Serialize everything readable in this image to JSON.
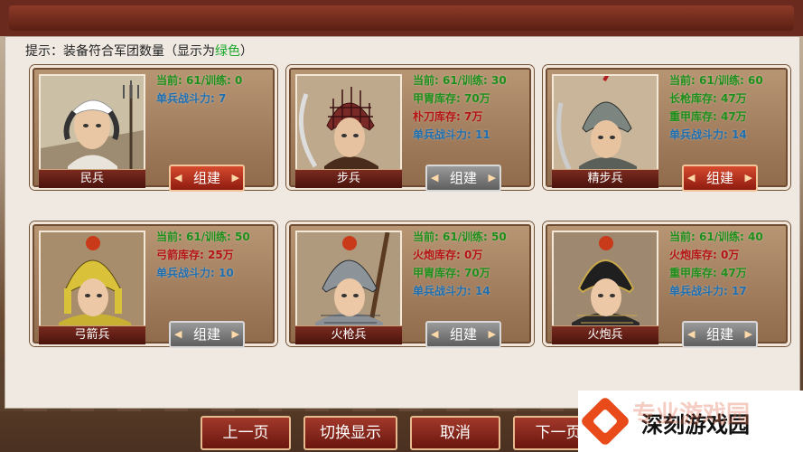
{
  "hint": {
    "prefix": "提示：装备符合军团数量（显示为",
    "highlight": "绿色",
    "suffix": "）"
  },
  "units": [
    {
      "name": "民兵",
      "button": "组建",
      "button_state": "active",
      "stats": [
        {
          "text": "当前: 61/训练: 0",
          "color": "green"
        },
        {
          "text": "单兵战斗力: 7",
          "color": "blue"
        }
      ]
    },
    {
      "name": "步兵",
      "button": "组建",
      "button_state": "disabled",
      "stats": [
        {
          "text": "当前: 61/训练: 30",
          "color": "green"
        },
        {
          "text": "甲胄库存: 70万",
          "color": "green"
        },
        {
          "text": "朴刀库存: 7万",
          "color": "red"
        },
        {
          "text": "单兵战斗力: 11",
          "color": "blue"
        }
      ]
    },
    {
      "name": "精步兵",
      "button": "组建",
      "button_state": "active",
      "stats": [
        {
          "text": "当前: 61/训练: 60",
          "color": "green"
        },
        {
          "text": "长枪库存: 47万",
          "color": "green"
        },
        {
          "text": "重甲库存: 47万",
          "color": "green"
        },
        {
          "text": "单兵战斗力: 14",
          "color": "blue"
        }
      ]
    },
    {
      "name": "弓箭兵",
      "button": "组建",
      "button_state": "disabled",
      "stats": [
        {
          "text": "当前: 61/训练: 50",
          "color": "green"
        },
        {
          "text": "弓箭库存: 25万",
          "color": "red"
        },
        {
          "text": "单兵战斗力: 10",
          "color": "blue"
        }
      ]
    },
    {
      "name": "火枪兵",
      "button": "组建",
      "button_state": "disabled",
      "stats": [
        {
          "text": "当前: 61/训练: 50",
          "color": "green"
        },
        {
          "text": "火炮库存: 0万",
          "color": "red"
        },
        {
          "text": "甲胄库存: 70万",
          "color": "green"
        },
        {
          "text": "单兵战斗力: 14",
          "color": "blue"
        }
      ]
    },
    {
      "name": "火炮兵",
      "button": "组建",
      "button_state": "disabled",
      "stats": [
        {
          "text": "当前: 61/训练: 40",
          "color": "green"
        },
        {
          "text": "火炮库存: 0万",
          "color": "red"
        },
        {
          "text": "重甲库存: 47万",
          "color": "green"
        },
        {
          "text": "单兵战斗力: 17",
          "color": "blue"
        }
      ]
    }
  ],
  "footer": {
    "prev": "上一页",
    "toggle": "切换显示",
    "cancel": "取消",
    "next": "下一页"
  },
  "watermark": {
    "text": "深刻游戏园",
    "ghost": "专业游戏园"
  },
  "colors": {
    "green": "#1e8f1a",
    "red": "#b41414",
    "blue": "#1f6fb0",
    "accent": "#8e1b10"
  }
}
